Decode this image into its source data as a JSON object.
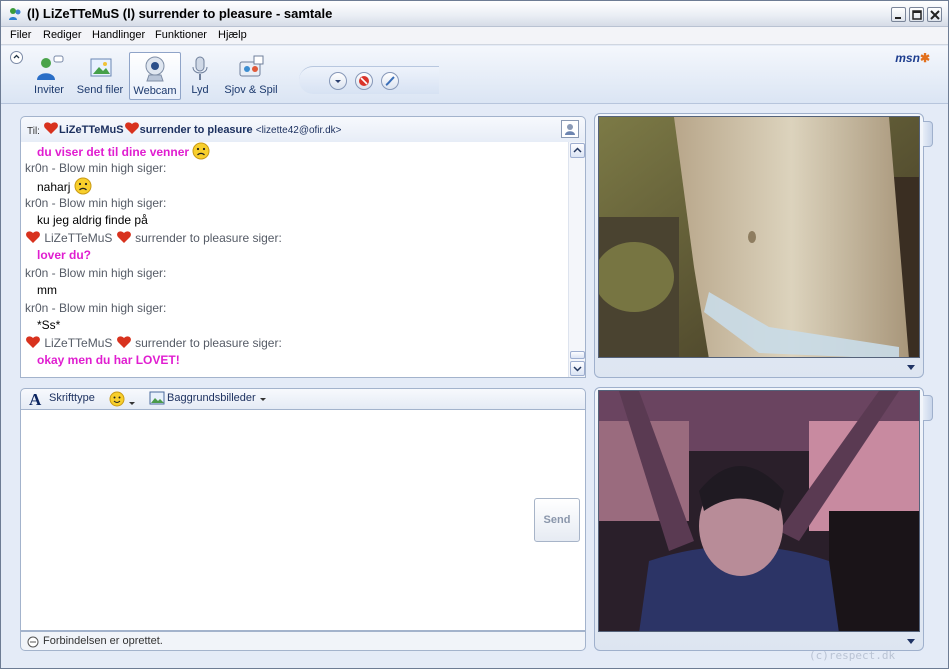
{
  "window": {
    "title": "(l) LiZeTTeMuS (l) surrender to pleasure - samtale"
  },
  "menu": [
    "Filer",
    "Rediger",
    "Handlinger",
    "Funktioner",
    "Hjælp"
  ],
  "toolbar": {
    "buttons": [
      {
        "label": "Inviter",
        "icon": "invite-icon"
      },
      {
        "label": "Send filer",
        "icon": "send-files-icon"
      },
      {
        "label": "Webcam",
        "icon": "webcam-icon",
        "active": true
      },
      {
        "label": "Lyd",
        "icon": "microphone-icon"
      },
      {
        "label": "Sjov & Spil",
        "icon": "games-icon"
      }
    ],
    "brand": "msn"
  },
  "to_bar": {
    "label": "Til:",
    "contact_name_1": "LiZeTTeMuS",
    "contact_name_2": "surrender to pleasure",
    "email": "<lizette42@ofir.dk>"
  },
  "conversation": {
    "lines": [
      {
        "type": "msg",
        "style": "pink",
        "text": "du viser det til dine venner",
        "emote": "sad"
      },
      {
        "type": "header",
        "sender": "kr0n - Blow min high siger:"
      },
      {
        "type": "msg",
        "style": "plain",
        "text": "naharj",
        "emote": "sad"
      },
      {
        "type": "header",
        "sender": "kr0n - Blow min high siger:"
      },
      {
        "type": "msg",
        "style": "plain",
        "text": "ku jeg aldrig finde på"
      },
      {
        "type": "header",
        "hearts": true,
        "name": "LiZeTTeMuS",
        "sender": "surrender to pleasure siger:"
      },
      {
        "type": "msg",
        "style": "pink",
        "text": "lover du?"
      },
      {
        "type": "header",
        "sender": "kr0n - Blow min high siger:"
      },
      {
        "type": "msg",
        "style": "plain",
        "text": "mm"
      },
      {
        "type": "header",
        "sender": "kr0n - Blow min high siger:"
      },
      {
        "type": "msg",
        "style": "plain",
        "text": "*Ss*"
      },
      {
        "type": "header",
        "hearts": true,
        "name": "LiZeTTeMuS",
        "sender": "surrender to pleasure siger:"
      },
      {
        "type": "msg",
        "style": "pink",
        "text": "okay men du har LOVET!"
      }
    ]
  },
  "format_bar": {
    "font_label": "Skrifttype",
    "backgrounds_label": "Baggrundsbilleder"
  },
  "compose": {
    "send_label": "Send"
  },
  "status": {
    "text": "Forbindelsen er oprettet."
  },
  "watermark": "(c)respect.dk",
  "colors": {
    "pink_text": "#e01ed0",
    "heart": "#d8321e",
    "frame_blue": "#a3b3cc"
  }
}
